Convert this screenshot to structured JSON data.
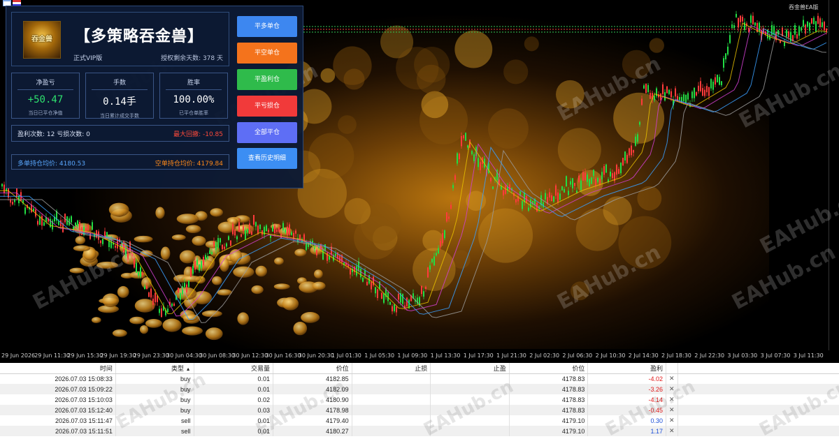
{
  "chart": {
    "top_label": "吞金兽EA版",
    "x_ticks": [
      "29 Jun 2026",
      "29 Jun 11:30",
      "29 Jun 15:30",
      "29 Jun 19:30",
      "29 Jun 23:30",
      "30 Jun 04:30",
      "30 Jun 08:30",
      "30 Jun 12:30",
      "30 Jun 16:30",
      "30 Jun 20:30",
      "1 Jul 01:30",
      "1 Jul 05:30",
      "1 Jul 09:30",
      "1 Jul 13:30",
      "1 Jul 17:30",
      "1 Jul 21:30",
      "2 Jul 02:30",
      "2 Jul 06:30",
      "2 Jul 10:30",
      "2 Jul 14:30",
      "2 Jul 18:30",
      "2 Jul 22:30",
      "3 Jul 03:30",
      "3 Jul 07:30",
      "3 Jul 11:30"
    ],
    "watermark": "EAHub.cn"
  },
  "panel": {
    "logo_text": "吞金兽",
    "title": "【多策略吞金兽】",
    "edition": "正式VIP版",
    "license": "授权剩余天数: 378 天",
    "net_pnl": {
      "label": "净盈亏",
      "value": "+50.47",
      "sub": "当日已平仓净值"
    },
    "lots": {
      "label": "手数",
      "value": "0.14手",
      "sub": "当日累计成交手数"
    },
    "winrate": {
      "label": "胜率",
      "value": "100.00%",
      "sub": "已平仓单胜率"
    },
    "counts": "盈利次数: 12   亏损次数: 0",
    "max_drawdown": "最大回撤: -10.85",
    "long_avg": "多单持仓均价: 4180.53",
    "short_avg": "空单持仓均价: 4179.84",
    "buttons": [
      "平多单仓",
      "平空单仓",
      "平盈利仓",
      "平亏损仓",
      "全部平仓",
      "查看历史明细"
    ]
  },
  "table": {
    "headers": [
      "时间",
      "类型",
      "交易量",
      "价位",
      "止损",
      "止盈",
      "价位",
      "盈利"
    ],
    "sort_indicator": "▲",
    "close_glyph": "✕",
    "rows": [
      {
        "time": "2026.07.03 15:08:33",
        "type": "buy",
        "volume": "0.01",
        "price": "4182.85",
        "sl": "",
        "tp": "",
        "current": "4178.83",
        "profit": "-4.02"
      },
      {
        "time": "2026.07.03 15:09:22",
        "type": "buy",
        "volume": "0.01",
        "price": "4182.09",
        "sl": "",
        "tp": "",
        "current": "4178.83",
        "profit": "-3.26"
      },
      {
        "time": "2026.07.03 15:10:03",
        "type": "buy",
        "volume": "0.02",
        "price": "4180.90",
        "sl": "",
        "tp": "",
        "current": "4178.83",
        "profit": "-4.14"
      },
      {
        "time": "2026.07.03 15:12:40",
        "type": "buy",
        "volume": "0.03",
        "price": "4178.98",
        "sl": "",
        "tp": "",
        "current": "4178.83",
        "profit": "-0.45"
      },
      {
        "time": "2026.07.03 15:11:47",
        "type": "sell",
        "volume": "0.01",
        "price": "4179.40",
        "sl": "",
        "tp": "",
        "current": "4179.10",
        "profit": "0.30"
      },
      {
        "time": "2026.07.03 15:11:51",
        "type": "sell",
        "volume": "0.01",
        "price": "4180.27",
        "sl": "",
        "tp": "",
        "current": "4179.10",
        "profit": "1.17"
      }
    ]
  },
  "colors": {
    "up": "#22dd44",
    "down": "#ff3b3b",
    "neg_profit": "#e01818",
    "pos_profit": "#1b4fd8"
  }
}
